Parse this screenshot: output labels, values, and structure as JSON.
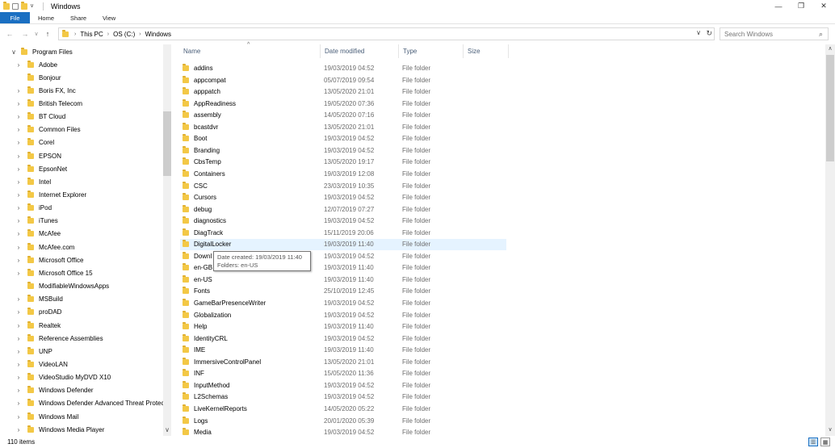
{
  "window": {
    "title": "Windows",
    "minimize": "—",
    "maximize": "❐",
    "close": "✕"
  },
  "ribbon": {
    "tabs": [
      {
        "label": "File"
      },
      {
        "label": "Home"
      },
      {
        "label": "Share"
      },
      {
        "label": "View"
      }
    ]
  },
  "address": {
    "crumbs": [
      "This PC",
      "OS (C:)",
      "Windows"
    ],
    "separator": "›",
    "back": "←",
    "forward": "→",
    "recent": "∨",
    "up": "↑",
    "dropdown": "∨",
    "refresh": "↻"
  },
  "search": {
    "placeholder": "Search Windows",
    "icon": "⌕"
  },
  "tree": {
    "root": {
      "label": "Program Files",
      "chevron": "∨"
    },
    "items": [
      {
        "label": "Adobe",
        "chevron": "›"
      },
      {
        "label": "Bonjour",
        "chevron": ""
      },
      {
        "label": "Boris FX, Inc",
        "chevron": "›"
      },
      {
        "label": "British Telecom",
        "chevron": "›"
      },
      {
        "label": "BT Cloud",
        "chevron": "›"
      },
      {
        "label": "Common Files",
        "chevron": "›"
      },
      {
        "label": "Corel",
        "chevron": "›"
      },
      {
        "label": "EPSON",
        "chevron": "›"
      },
      {
        "label": "EpsonNet",
        "chevron": "›"
      },
      {
        "label": "Intel",
        "chevron": "›"
      },
      {
        "label": "Internet Explorer",
        "chevron": "›"
      },
      {
        "label": "iPod",
        "chevron": "›"
      },
      {
        "label": "iTunes",
        "chevron": "›"
      },
      {
        "label": "McAfee",
        "chevron": "›"
      },
      {
        "label": "McAfee.com",
        "chevron": "›"
      },
      {
        "label": "Microsoft Office",
        "chevron": "›"
      },
      {
        "label": "Microsoft Office 15",
        "chevron": "›"
      },
      {
        "label": "ModifiableWindowsApps",
        "chevron": ""
      },
      {
        "label": "MSBuild",
        "chevron": "›"
      },
      {
        "label": "proDAD",
        "chevron": "›"
      },
      {
        "label": "Realtek",
        "chevron": "›"
      },
      {
        "label": "Reference Assemblies",
        "chevron": "›"
      },
      {
        "label": "UNP",
        "chevron": "›"
      },
      {
        "label": "VideoLAN",
        "chevron": "›"
      },
      {
        "label": "VideoStudio MyDVD X10",
        "chevron": "›"
      },
      {
        "label": "Windows Defender",
        "chevron": "›"
      },
      {
        "label": "Windows Defender Advanced Threat Protec",
        "chevron": "›"
      },
      {
        "label": "Windows Mail",
        "chevron": "›"
      },
      {
        "label": "Windows Media Player",
        "chevron": "›"
      }
    ],
    "scroll_down": "∨"
  },
  "columns": {
    "name": "Name",
    "date": "Date modified",
    "type": "Type",
    "size": "Size",
    "sort_indicator": "^"
  },
  "files": [
    {
      "name": "addins",
      "date": "19/03/2019 04:52",
      "type": "File folder"
    },
    {
      "name": "appcompat",
      "date": "05/07/2019 09:54",
      "type": "File folder"
    },
    {
      "name": "apppatch",
      "date": "13/05/2020 21:01",
      "type": "File folder"
    },
    {
      "name": "AppReadiness",
      "date": "19/05/2020 07:36",
      "type": "File folder"
    },
    {
      "name": "assembly",
      "date": "14/05/2020 07:16",
      "type": "File folder"
    },
    {
      "name": "bcastdvr",
      "date": "13/05/2020 21:01",
      "type": "File folder"
    },
    {
      "name": "Boot",
      "date": "19/03/2019 04:52",
      "type": "File folder"
    },
    {
      "name": "Branding",
      "date": "19/03/2019 04:52",
      "type": "File folder"
    },
    {
      "name": "CbsTemp",
      "date": "13/05/2020 19:17",
      "type": "File folder"
    },
    {
      "name": "Containers",
      "date": "19/03/2019 12:08",
      "type": "File folder"
    },
    {
      "name": "CSC",
      "date": "23/03/2019 10:35",
      "type": "File folder"
    },
    {
      "name": "Cursors",
      "date": "19/03/2019 04:52",
      "type": "File folder"
    },
    {
      "name": "debug",
      "date": "12/07/2019 07:27",
      "type": "File folder"
    },
    {
      "name": "diagnostics",
      "date": "19/03/2019 04:52",
      "type": "File folder"
    },
    {
      "name": "DiagTrack",
      "date": "15/11/2019 20:06",
      "type": "File folder"
    },
    {
      "name": "DigitalLocker",
      "date": "19/03/2019 11:40",
      "type": "File folder"
    },
    {
      "name": "Downl",
      "date": "19/03/2019 04:52",
      "type": "File folder"
    },
    {
      "name": "en-GB",
      "date": "19/03/2019 11:40",
      "type": "File folder"
    },
    {
      "name": "en-US",
      "date": "19/03/2019 11:40",
      "type": "File folder"
    },
    {
      "name": "Fonts",
      "date": "25/10/2019 12:45",
      "type": "File folder"
    },
    {
      "name": "GameBarPresenceWriter",
      "date": "19/03/2019 04:52",
      "type": "File folder"
    },
    {
      "name": "Globalization",
      "date": "19/03/2019 04:52",
      "type": "File folder"
    },
    {
      "name": "Help",
      "date": "19/03/2019 11:40",
      "type": "File folder"
    },
    {
      "name": "IdentityCRL",
      "date": "19/03/2019 04:52",
      "type": "File folder"
    },
    {
      "name": "IME",
      "date": "19/03/2019 11:40",
      "type": "File folder"
    },
    {
      "name": "ImmersiveControlPanel",
      "date": "13/05/2020 21:01",
      "type": "File folder"
    },
    {
      "name": "INF",
      "date": "15/05/2020 11:36",
      "type": "File folder"
    },
    {
      "name": "InputMethod",
      "date": "19/03/2019 04:52",
      "type": "File folder"
    },
    {
      "name": "L2Schemas",
      "date": "19/03/2019 04:52",
      "type": "File folder"
    },
    {
      "name": "LiveKernelReports",
      "date": "14/05/2020 05:22",
      "type": "File folder"
    },
    {
      "name": "Logs",
      "date": "20/01/2020 05:39",
      "type": "File folder"
    },
    {
      "name": "Media",
      "date": "19/03/2019 04:52",
      "type": "File folder"
    }
  ],
  "tooltip": {
    "line1": "Date created: 19/03/2019 11:40",
    "line2": "Folders: en-US"
  },
  "scrollbar": {
    "up": "∧",
    "down": "∨"
  },
  "status": {
    "item_count": "110 items",
    "details_view": "☰",
    "tiles_view": "▦"
  },
  "colors": {
    "accent": "#1a6fc2",
    "folder": "#f3c846",
    "hover": "#e5f3ff"
  }
}
